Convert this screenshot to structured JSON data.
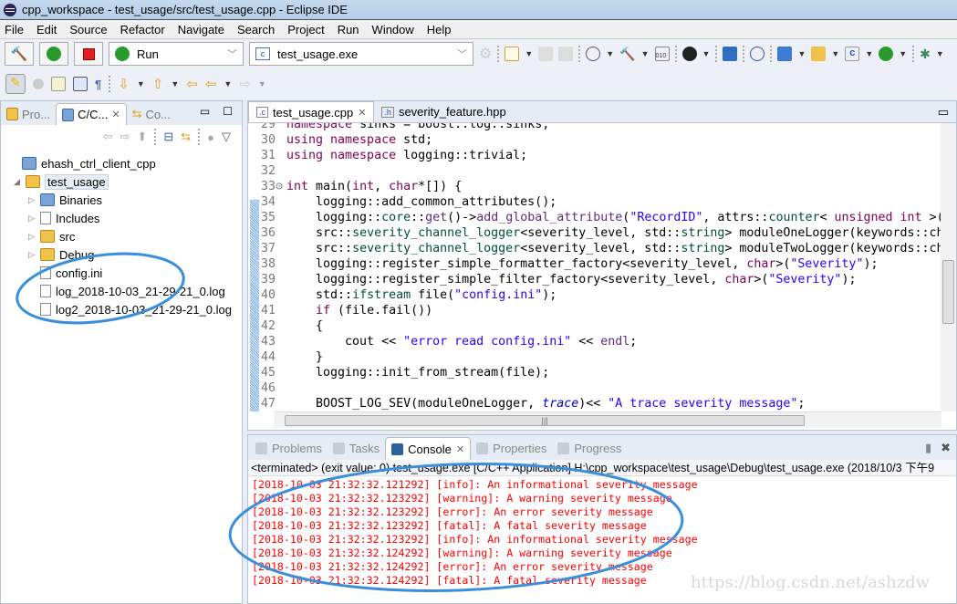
{
  "window": {
    "title": "cpp_workspace - test_usage/src/test_usage.cpp - Eclipse IDE"
  },
  "menu": [
    "File",
    "Edit",
    "Source",
    "Refactor",
    "Navigate",
    "Search",
    "Project",
    "Run",
    "Window",
    "Help"
  ],
  "toolbar": {
    "launch_mode": "Run",
    "launch_config": "test_usage.exe"
  },
  "left_panel": {
    "tabs": [
      "Pro...",
      "C/C...",
      "Co..."
    ],
    "tree": [
      {
        "label": "ehash_ctrl_client_cpp",
        "icon": "project-icon",
        "level": 0,
        "twisty": ""
      },
      {
        "label": "test_usage",
        "icon": "c-project-icon",
        "level": 0,
        "twisty": "expanded"
      },
      {
        "label": "Binaries",
        "icon": "binaries-icon",
        "level": 1,
        "twisty": "collapsed"
      },
      {
        "label": "Includes",
        "icon": "includes-icon",
        "level": 1,
        "twisty": "collapsed"
      },
      {
        "label": "src",
        "icon": "source-folder-icon",
        "level": 1,
        "twisty": "collapsed"
      },
      {
        "label": "Debug",
        "icon": "folder-icon",
        "level": 1,
        "twisty": "collapsed"
      },
      {
        "label": "config.ini",
        "icon": "file-icon",
        "level": 1,
        "twisty": ""
      },
      {
        "label": "log_2018-10-03_21-29-21_0.log",
        "icon": "file-icon",
        "level": 1,
        "twisty": ""
      },
      {
        "label": "log2_2018-10-03_21-29-21_0.log",
        "icon": "file-icon",
        "level": 1,
        "twisty": ""
      }
    ]
  },
  "editor": {
    "tabs": [
      {
        "label": "test_usage.cpp",
        "active": true
      },
      {
        "label": "severity_feature.hpp",
        "active": false
      }
    ],
    "lines": [
      {
        "n": "29",
        "t": [
          [
            "kw",
            "namespace"
          ],
          [
            "pl",
            " sinks = boost::log::sinks;"
          ]
        ]
      },
      {
        "n": "30",
        "t": [
          [
            "kw",
            "using namespace"
          ],
          [
            "pl",
            " std;"
          ]
        ]
      },
      {
        "n": "31",
        "t": [
          [
            "kw",
            "using namespace"
          ],
          [
            "pl",
            " logging::trivial;"
          ]
        ]
      },
      {
        "n": "32",
        "t": []
      },
      {
        "n": "33⊝",
        "t": [
          [
            "kw",
            "int"
          ],
          [
            "pl",
            " main("
          ],
          [
            "kw",
            "int"
          ],
          [
            "pl",
            ", "
          ],
          [
            "kw",
            "char"
          ],
          [
            "pl",
            "*[]) {"
          ]
        ]
      },
      {
        "n": "34",
        "t": [
          [
            "pl",
            "    logging::add_common_attributes();"
          ]
        ]
      },
      {
        "n": "35",
        "t": [
          [
            "pl",
            "    logging::"
          ],
          [
            "ty",
            "core"
          ],
          [
            "pl",
            "::"
          ],
          [
            "fn",
            "get"
          ],
          [
            "pl",
            "()->"
          ],
          [
            "fn",
            "add_global_attribute"
          ],
          [
            "pl",
            "("
          ],
          [
            "str",
            "\"RecordID\""
          ],
          [
            "pl",
            ", attrs::"
          ],
          [
            "ty",
            "counter"
          ],
          [
            "pl",
            "< "
          ],
          [
            "kw",
            "unsigned int"
          ],
          [
            "pl",
            " >("
          ]
        ]
      },
      {
        "n": "36",
        "t": [
          [
            "pl",
            "    src::"
          ],
          [
            "ty",
            "severity_channel_logger"
          ],
          [
            "pl",
            "<severity_level, std::"
          ],
          [
            "ty",
            "string"
          ],
          [
            "pl",
            "> moduleOneLogger(keywords::ch"
          ]
        ]
      },
      {
        "n": "37",
        "t": [
          [
            "pl",
            "    src::"
          ],
          [
            "ty",
            "severity_channel_logger"
          ],
          [
            "pl",
            "<severity_level, std::"
          ],
          [
            "ty",
            "string"
          ],
          [
            "pl",
            "> moduleTwoLogger(keywords::ch"
          ]
        ]
      },
      {
        "n": "38",
        "t": [
          [
            "pl",
            "    logging::register_simple_formatter_factory<severity_level, "
          ],
          [
            "kw",
            "char"
          ],
          [
            "pl",
            ">("
          ],
          [
            "str",
            "\"Severity\""
          ],
          [
            "pl",
            ");"
          ]
        ]
      },
      {
        "n": "39",
        "t": [
          [
            "pl",
            "    logging::register_simple_filter_factory<severity_level, "
          ],
          [
            "kw",
            "char"
          ],
          [
            "pl",
            ">("
          ],
          [
            "str",
            "\"Severity\""
          ],
          [
            "pl",
            ");"
          ]
        ]
      },
      {
        "n": "40",
        "t": [
          [
            "pl",
            "    std::"
          ],
          [
            "ty",
            "ifstream"
          ],
          [
            "pl",
            " file("
          ],
          [
            "str",
            "\"config.ini\""
          ],
          [
            "pl",
            ");"
          ]
        ]
      },
      {
        "n": "41",
        "t": [
          [
            "pl",
            "    "
          ],
          [
            "kw",
            "if"
          ],
          [
            "pl",
            " (file.fail())"
          ]
        ]
      },
      {
        "n": "42",
        "t": [
          [
            "pl",
            "    {"
          ]
        ]
      },
      {
        "n": "43",
        "t": [
          [
            "pl",
            "        cout << "
          ],
          [
            "str",
            "\"error read config.ini\""
          ],
          [
            "pl",
            " << "
          ],
          [
            "fn",
            "endl"
          ],
          [
            "pl",
            ";"
          ]
        ]
      },
      {
        "n": "44",
        "t": [
          [
            "pl",
            "    }"
          ]
        ]
      },
      {
        "n": "45",
        "t": [
          [
            "pl",
            "    logging::init_from_stream(file);"
          ]
        ]
      },
      {
        "n": "46",
        "t": []
      },
      {
        "n": "47",
        "t": [
          [
            "pl",
            "    BOOST_LOG_SEV(moduleOneLogger, "
          ],
          [
            "en",
            "trace"
          ],
          [
            "pl",
            ")<< "
          ],
          [
            "str",
            "\"A trace severity message\""
          ],
          [
            "pl",
            ";"
          ]
        ]
      }
    ]
  },
  "console": {
    "tabs": [
      {
        "label": "Problems",
        "active": false
      },
      {
        "label": "Tasks",
        "active": false
      },
      {
        "label": "Console",
        "active": true
      },
      {
        "label": "Properties",
        "active": false
      },
      {
        "label": "Progress",
        "active": false
      }
    ],
    "status": "<terminated> (exit value: 0) test_usage.exe [C/C++ Application] H:\\cpp_workspace\\test_usage\\Debug\\test_usage.exe (2018/10/3 下午9",
    "output": [
      "[2018-10-03 21:32:32.121292] [info]: An informational severity message",
      "[2018-10-03 21:32:32.123292] [warning]: A warning severity message",
      "[2018-10-03 21:32:32.123292] [error]: An error severity message",
      "[2018-10-03 21:32:32.123292] [fatal]: A fatal severity message",
      "[2018-10-03 21:32:32.123292] [info]: An informational severity message",
      "[2018-10-03 21:32:32.124292] [warning]: A warning severity message",
      "[2018-10-03 21:32:32.124292] [error]: An error severity message",
      "[2018-10-03 21:32:32.124292] [fatal]: A fatal severity message"
    ],
    "output_color": "#ff0000"
  },
  "watermark": "https://blog.csdn.net/ashzdw",
  "annotation_color": "#3a8fdc"
}
